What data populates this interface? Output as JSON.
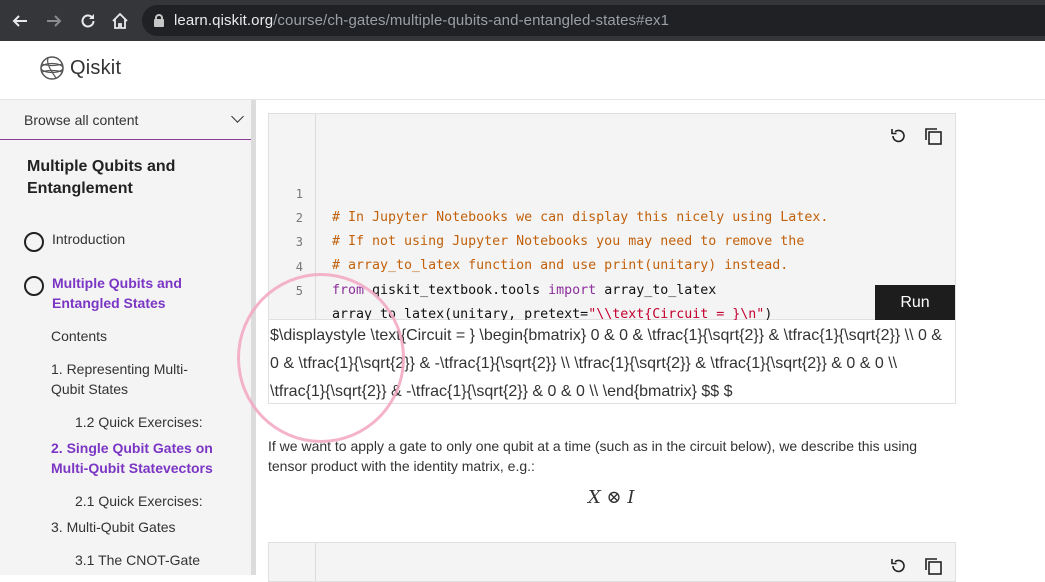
{
  "browser": {
    "url_host": "learn.qiskit.org",
    "url_path": "/course/ch-gates/multiple-qubits-and-entangled-states#ex1",
    "icons": [
      "back-icon",
      "forward-icon",
      "reload-icon",
      "home-icon",
      "lock-icon"
    ]
  },
  "header": {
    "logo_text": "Qiskit"
  },
  "sidebar": {
    "browse_label": "Browse all content",
    "title": "Multiple Qubits and Entanglement",
    "items": [
      {
        "label": "Introduction"
      },
      {
        "label": "Multiple Qubits and Entangled States"
      },
      {
        "label": "Contents"
      },
      {
        "label": "1. Representing Multi-Qubit States"
      },
      {
        "label": "1.2 Quick Exercises:"
      },
      {
        "label": "2. Single Qubit Gates on Multi-Qubit Statevectors"
      },
      {
        "label": "2.1 Quick Exercises:"
      },
      {
        "label": "3. Multi-Qubit Gates"
      },
      {
        "label": "3.1 The CNOT-Gate"
      }
    ]
  },
  "code_cell": {
    "line_numbers": [
      "1",
      "2",
      "3",
      "4",
      "5"
    ],
    "line1": "# In Jupyter Notebooks we can display this nicely using Latex.",
    "line2": "# If not using Jupyter Notebooks you may need to remove the",
    "line3": "# array_to_latex function and use print(unitary) instead.",
    "line4_kw1": "from",
    "line4_mod": " qiskit_textbook.tools ",
    "line4_kw2": "import",
    "line4_name": " array_to_latex",
    "line5_pre": "array_to_latex(unitary, pretext=",
    "line5_str": "\"\\\\text{Circuit = }\\n\"",
    "line5_post": ")",
    "run_label": "Run"
  },
  "output": {
    "text": "$\\displaystyle \\text{Circuit = } \\begin{bmatrix} 0 & 0 & \\tfrac{1}{\\sqrt{2}} & \\tfrac{1}{\\sqrt{2}} \\\\ 0 & 0 & \\tfrac{1}{\\sqrt{2}} & -\\tfrac{1}{\\sqrt{2}} \\\\ \\tfrac{1}{\\sqrt{2}} & \\tfrac{1}{\\sqrt{2}} & 0 & 0 \\\\ \\tfrac{1}{\\sqrt{2}} & -\\tfrac{1}{\\sqrt{2}} & 0 & 0 \\\\ \\end{bmatrix} $$ $"
  },
  "body": {
    "paragraph": "If we want to apply a gate to only one qubit at a time (such as in the circuit below), we describe this using tensor product with the identity matrix, e.g.:",
    "math": "X ⊗ I"
  }
}
